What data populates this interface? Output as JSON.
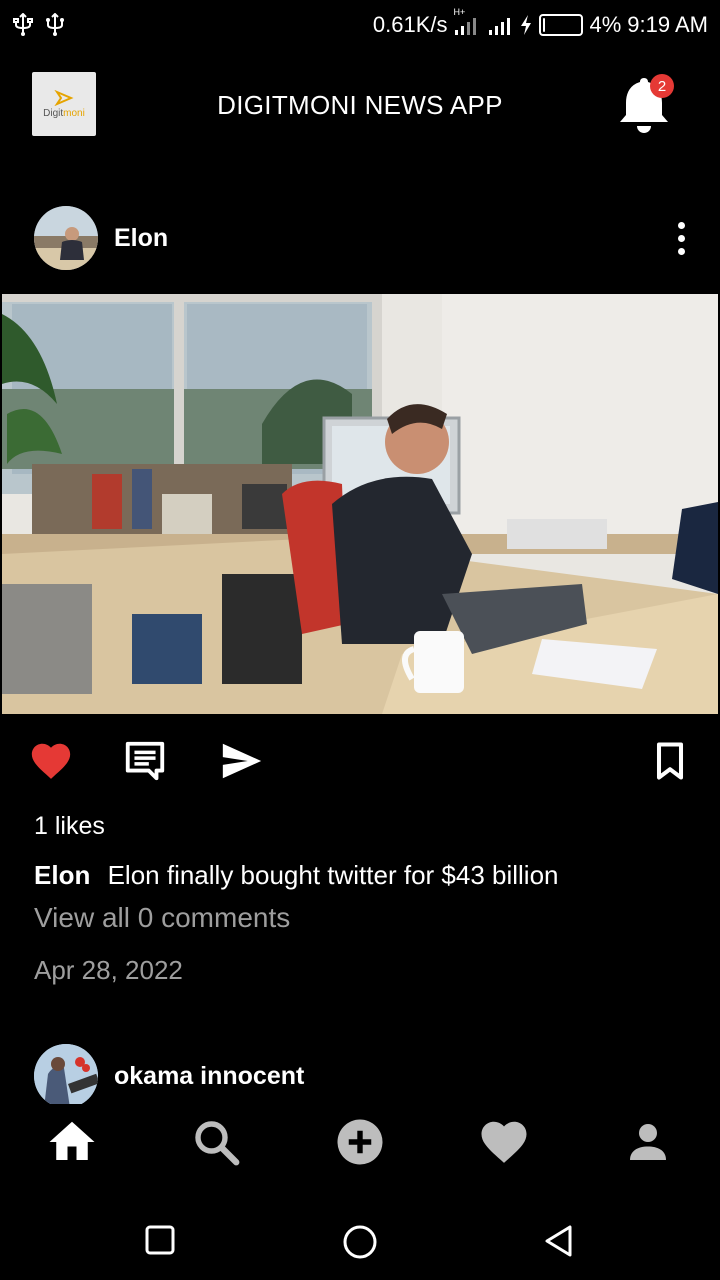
{
  "status_bar": {
    "speed": "0.61K/s",
    "network": "H+",
    "battery": "4%",
    "battery_level": 0.04,
    "time": "9:19 AM"
  },
  "header": {
    "logo_text_a": "Digit",
    "logo_text_b": "moni",
    "title": "DIGITMONI NEWS APP",
    "notification_count": "2"
  },
  "post": {
    "author": "Elon",
    "likes": "1 likes",
    "caption_author": "Elon",
    "caption_text": "Elon finally bought twitter for $43 billion",
    "comments": "View all 0 comments",
    "date": "Apr 28, 2022"
  },
  "next_post": {
    "author": "okama innocent"
  },
  "colors": {
    "like": "#e53935",
    "badge": "#e53935",
    "muted": "#9e9e9e"
  },
  "icons": {
    "actions": [
      "heart-icon",
      "comment-icon",
      "send-icon",
      "bookmark-icon"
    ],
    "nav": [
      "home-icon",
      "search-icon",
      "add-icon",
      "heart-icon",
      "profile-icon"
    ],
    "system": [
      "square-icon",
      "circle-icon",
      "back-triangle-icon"
    ]
  }
}
